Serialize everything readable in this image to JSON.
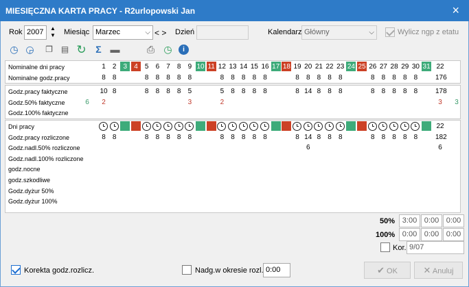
{
  "title": "MIESIĘCZNA KARTA PRACY - R2urlopowski Jan",
  "close_icon": "×",
  "form": {
    "rok_label": "Rok",
    "rok_value": "2007",
    "miesiac_label": "Miesiąc",
    "miesiac_value": "Marzec",
    "nav_label": "< >",
    "dzien_label": "Dzień",
    "dzien_value": "",
    "kalendarz_label": "Kalendarz",
    "kalendarz_value": "Główny",
    "wylicz_label": "Wylicz ngp z etatu"
  },
  "toolbar": [
    "add-clock-icon",
    "remove-clock-icon",
    "copy-icon",
    "paste-icon",
    "refresh-icon",
    "sum-icon",
    "folder-icon",
    "print-icon",
    "check-clock-icon",
    "info-icon"
  ],
  "colors": {
    "green": "#3eab7a",
    "red": "#cc4125",
    "label_red": "#c0392b",
    "label_green": "#3a9a6a"
  },
  "grid": {
    "days": [
      "1",
      "2",
      "3",
      "4",
      "5",
      "6",
      "7",
      "8",
      "9",
      "10",
      "11",
      "12",
      "13",
      "14",
      "15",
      "16",
      "17",
      "18",
      "19",
      "20",
      "21",
      "22",
      "23",
      "24",
      "25",
      "26",
      "27",
      "28",
      "29",
      "30",
      "31"
    ],
    "day_colors": {
      "3": "green",
      "4": "red",
      "10": "green",
      "11": "red",
      "17": "green",
      "18": "red",
      "24": "green",
      "25": "red",
      "31": "green"
    },
    "section1": {
      "rows": [
        {
          "label": "Nominalne dni pracy",
          "total": "22"
        },
        {
          "label": "Nominalne godz.pracy",
          "values": {
            "1": "8",
            "2": "8",
            "5": "8",
            "6": "8",
            "7": "8",
            "8": "8",
            "9": "8",
            "12": "8",
            "13": "8",
            "14": "8",
            "15": "8",
            "16": "8",
            "19": "8",
            "20": "8",
            "21": "8",
            "22": "8",
            "23": "8",
            "26": "8",
            "27": "8",
            "28": "8",
            "29": "8",
            "30": "8"
          },
          "total": "176"
        }
      ]
    },
    "section2": {
      "rows": [
        {
          "label": "Godz.pracy faktyczne",
          "values": {
            "1": "10",
            "2": "8",
            "5": "8",
            "6": "8",
            "7": "8",
            "8": "8",
            "9": "5",
            "12": "5",
            "13": "8",
            "14": "8",
            "15": "8",
            "16": "8",
            "19": "8",
            "20": "14",
            "21": "8",
            "22": "8",
            "23": "8",
            "26": "8",
            "27": "8",
            "28": "8",
            "29": "8",
            "30": "8"
          },
          "total": "178"
        },
        {
          "label": "Godz.50% faktyczne",
          "pre": "6",
          "values": {
            "1": "2",
            "9": "3",
            "12": "2"
          },
          "total": "3",
          "post": "3"
        },
        {
          "label": "Godz.100% faktyczne"
        }
      ]
    },
    "section3": {
      "day_marks": [
        "clock",
        "clock",
        "green",
        "red",
        "clock",
        "clock",
        "clock",
        "clock",
        "clock",
        "green",
        "red",
        "clock",
        "clock",
        "clock",
        "clock",
        "clock",
        "green",
        "red",
        "clock",
        "clock",
        "clock",
        "clock",
        "clock",
        "green",
        "red",
        "clock",
        "clock",
        "clock",
        "clock",
        "clock",
        "green"
      ],
      "rows": [
        {
          "label": "Dni pracy",
          "total": "22"
        },
        {
          "label": "Godz.pracy rozliczone",
          "values": {
            "1": "8",
            "2": "8",
            "5": "8",
            "6": "8",
            "7": "8",
            "8": "8",
            "9": "8",
            "12": "8",
            "13": "8",
            "14": "8",
            "15": "8",
            "16": "8",
            "19": "8",
            "20": "14",
            "21": "8",
            "22": "8",
            "23": "8",
            "26": "8",
            "27": "8",
            "28": "8",
            "29": "8",
            "30": "8"
          },
          "total": "182"
        },
        {
          "label": "Godz.nadl.50% rozliczone",
          "values": {
            "20": "6"
          },
          "total": "6"
        },
        {
          "label": "Godz.nadl.100% rozliczone"
        },
        {
          "label": "godz.nocne"
        },
        {
          "label": "godz.szkodliwe"
        },
        {
          "label": "Godz.dyżur 50%"
        },
        {
          "label": "Godz.dyżur 100%"
        }
      ]
    }
  },
  "summary": {
    "row50_label": "50%",
    "row50": [
      "3:00",
      "0:00",
      "0:00"
    ],
    "row100_label": "100%",
    "row100": [
      "0:00",
      "0:00",
      "0:00"
    ],
    "kor_label": "Kor.",
    "kor_value": "9/07"
  },
  "bottom": {
    "korekta_label": "Korekta godz.rozlicz.",
    "nadg_label": "Nadg.w okresie rozl.",
    "nadg_value": "0:00",
    "ok_label": "OK",
    "anuluj_label": "Anuluj"
  }
}
